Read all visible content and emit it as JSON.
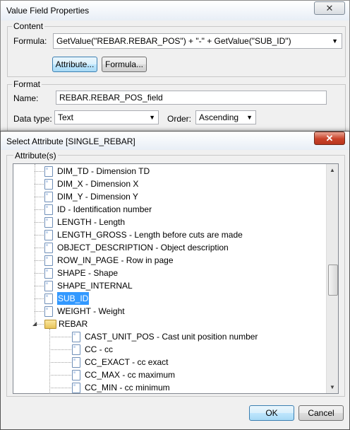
{
  "back_dialog": {
    "title": "Value Field Properties",
    "close_glyph": "✕",
    "content_group": "Content",
    "formula_label": "Formula:",
    "formula_value": "GetValue(\"REBAR.REBAR_POS\") + \"-\" + GetValue(\"SUB_ID\")",
    "attribute_button": "Attribute...",
    "formula_button": "Formula...",
    "format_group": "Format",
    "name_label": "Name:",
    "name_value": "REBAR.REBAR_POS_field",
    "datatype_label": "Data type:",
    "datatype_value": "Text",
    "order_label": "Order:",
    "order_value": "Ascending"
  },
  "select_dialog": {
    "title": "Select Attribute [SINGLE_REBAR]",
    "close_glyph": "✕",
    "group_label": "Attribute(s)",
    "ok_button": "OK",
    "cancel_button": "Cancel"
  },
  "tree": {
    "items": [
      {
        "label": "DIM_TD  -  Dimension TD",
        "kind": "doc",
        "level": 1
      },
      {
        "label": "DIM_X  -  Dimension X",
        "kind": "doc",
        "level": 1
      },
      {
        "label": "DIM_Y  -  Dimension Y",
        "kind": "doc",
        "level": 1
      },
      {
        "label": "ID  -  Identification number",
        "kind": "doc",
        "level": 1
      },
      {
        "label": "LENGTH  -  Length",
        "kind": "doc",
        "level": 1
      },
      {
        "label": "LENGTH_GROSS  -  Length before cuts are made",
        "kind": "doc",
        "level": 1
      },
      {
        "label": "OBJECT_DESCRIPTION  -  Object description",
        "kind": "doc",
        "level": 1
      },
      {
        "label": "ROW_IN_PAGE  -  Row in page",
        "kind": "doc",
        "level": 1
      },
      {
        "label": "SHAPE  -  Shape",
        "kind": "doc",
        "level": 1
      },
      {
        "label": "SHAPE_INTERNAL",
        "kind": "doc",
        "level": 1
      },
      {
        "label": "SUB_ID",
        "kind": "doc",
        "level": 1,
        "selected": true
      },
      {
        "label": "WEIGHT  -  Weight",
        "kind": "doc",
        "level": 1
      },
      {
        "label": "REBAR",
        "kind": "folder",
        "level": 1,
        "expanded": true
      },
      {
        "label": "CAST_UNIT_POS  -  Cast unit position number",
        "kind": "doc",
        "level": 2
      },
      {
        "label": "CC  -  cc",
        "kind": "doc",
        "level": 2
      },
      {
        "label": "CC_EXACT  -  cc exact",
        "kind": "doc",
        "level": 2
      },
      {
        "label": "CC_MAX  -  cc maximum",
        "kind": "doc",
        "level": 2
      },
      {
        "label": "CC_MIN  -  cc minimum",
        "kind": "doc",
        "level": 2
      }
    ],
    "expander_glyph": "◢",
    "scroll_up_glyph": "▲",
    "scroll_down_glyph": "▼"
  }
}
